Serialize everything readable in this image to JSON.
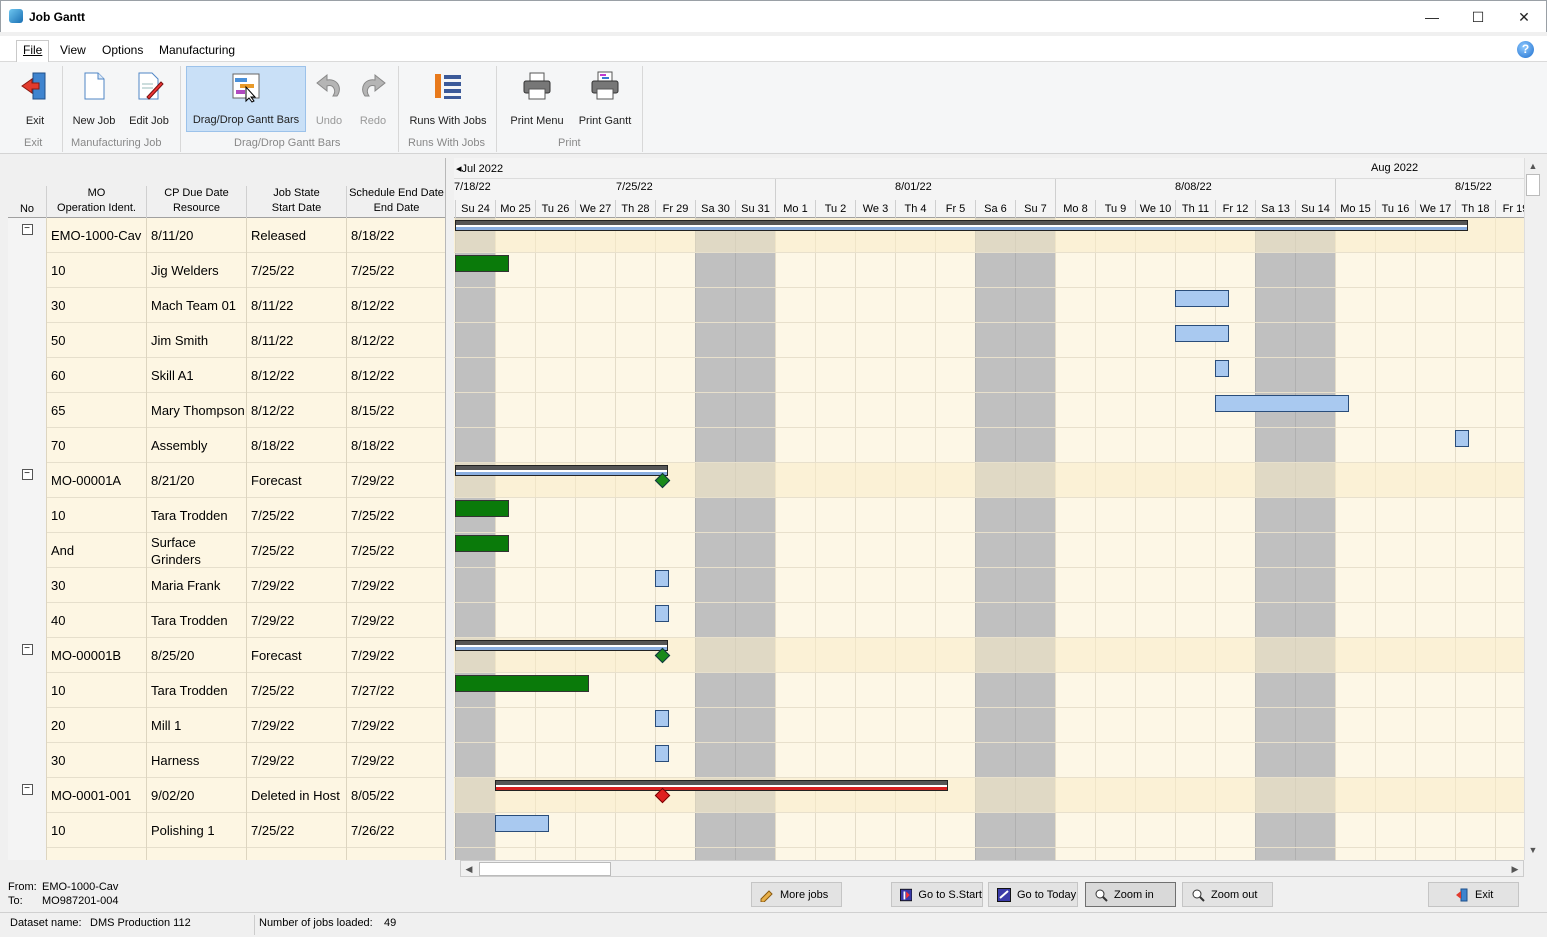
{
  "window": {
    "title": "Job Gantt",
    "minimize": "—",
    "maximize": "☐",
    "close": "✕"
  },
  "menu": {
    "file": "File",
    "view": "View",
    "options": "Options",
    "manufacturing": "Manufacturing",
    "help": "?"
  },
  "ribbon": {
    "exit": "Exit",
    "new_job": "New Job",
    "edit_job": "Edit Job",
    "drag_drop": "Drag/Drop Gantt Bars",
    "undo": "Undo",
    "redo": "Redo",
    "runs_with_jobs": "Runs With Jobs",
    "print_menu": "Print Menu",
    "print_gantt": "Print Gantt",
    "groups": {
      "exit": "Exit",
      "manufacturing_job": "Manufacturing Job",
      "drag_drop": "Drag/Drop Gantt Bars",
      "runs_with_jobs": "Runs With Jobs",
      "print": "Print"
    }
  },
  "grid": {
    "headers": {
      "no": "No",
      "col1_a": "MO",
      "col1_b": "Operation Ident.",
      "col2_a": "CP Due Date",
      "col2_b": "Resource",
      "col3_a": "Job State",
      "col3_b": "Start Date",
      "col4_a": "Schedule End Date",
      "col4_b": "End Date"
    },
    "rows": [
      {
        "toggle": "−",
        "c1": "EMO-1000-Cav",
        "c2": "8/11/20",
        "c3": "Released",
        "c4": "8/18/22"
      },
      {
        "toggle": "",
        "c1": "10",
        "c2": "Jig Welders",
        "c3": "7/25/22",
        "c4": "7/25/22"
      },
      {
        "toggle": "",
        "c1": "30",
        "c2": "Mach Team 01",
        "c3": "8/11/22",
        "c4": "8/12/22"
      },
      {
        "toggle": "",
        "c1": "50",
        "c2": "Jim Smith",
        "c3": "8/11/22",
        "c4": "8/12/22"
      },
      {
        "toggle": "",
        "c1": "60",
        "c2": "Skill A1",
        "c3": "8/12/22",
        "c4": "8/12/22"
      },
      {
        "toggle": "",
        "c1": "65",
        "c2": "Mary Thompson",
        "c3": "8/12/22",
        "c4": "8/15/22"
      },
      {
        "toggle": "",
        "c1": "70",
        "c2": "Assembly",
        "c3": "8/18/22",
        "c4": "8/18/22"
      },
      {
        "toggle": "−",
        "c1": "MO-00001A",
        "c2": "8/21/20",
        "c3": "Forecast",
        "c4": "7/29/22"
      },
      {
        "toggle": "",
        "c1": "10",
        "c2": "Tara Trodden",
        "c3": "7/25/22",
        "c4": "7/25/22"
      },
      {
        "toggle": "",
        "c1": "And",
        "c2": "Surface Grinders",
        "c3": "7/25/22",
        "c4": "7/25/22"
      },
      {
        "toggle": "",
        "c1": "30",
        "c2": "Maria Frank",
        "c3": "7/29/22",
        "c4": "7/29/22"
      },
      {
        "toggle": "",
        "c1": "40",
        "c2": "Tara Trodden",
        "c3": "7/29/22",
        "c4": "7/29/22"
      },
      {
        "toggle": "−",
        "c1": "MO-00001B",
        "c2": "8/25/20",
        "c3": "Forecast",
        "c4": "7/29/22"
      },
      {
        "toggle": "",
        "c1": "10",
        "c2": "Tara Trodden",
        "c3": "7/25/22",
        "c4": "7/27/22"
      },
      {
        "toggle": "",
        "c1": "20",
        "c2": "Mill 1",
        "c3": "7/29/22",
        "c4": "7/29/22"
      },
      {
        "toggle": "",
        "c1": "30",
        "c2": "Harness",
        "c3": "7/29/22",
        "c4": "7/29/22"
      },
      {
        "toggle": "−",
        "c1": "MO-0001-001",
        "c2": "9/02/20",
        "c3": "Deleted in Host",
        "c4": "8/05/22"
      },
      {
        "toggle": "",
        "c1": "10",
        "c2": "Polishing 1",
        "c3": "7/25/22",
        "c4": "7/26/22"
      },
      {
        "toggle": "",
        "c1": "",
        "c2": "",
        "c3": "",
        "c4": ""
      }
    ]
  },
  "gantt": {
    "months": [
      {
        "label": "Jul 2022"
      },
      {
        "label": "Aug 2022"
      }
    ],
    "weeks": [
      "7/18/22",
      "7/25/22",
      "8/01/22",
      "8/08/22",
      "8/15/22"
    ],
    "days": [
      "Su 24",
      "Mo 25",
      "Tu 26",
      "We 27",
      "Th 28",
      "Fr 29",
      "Sa 30",
      "Su 31",
      "Mo 1",
      "Tu 2",
      "We 3",
      "Th 4",
      "Fr 5",
      "Sa 6",
      "Su 7",
      "Mo 8",
      "Tu 9",
      "We 10",
      "Th 11",
      "Fr 12",
      "Sa 13",
      "Su 14",
      "Mo 15",
      "Tu 16",
      "We 17",
      "Th 18",
      "Fr 19"
    ],
    "weekend_days": [
      "Su 24",
      "Sa 30",
      "Su 31",
      "Sa 6",
      "Su 7",
      "Sa 13",
      "Su 14"
    ]
  },
  "bottom": {
    "from_label": "From:",
    "from_value": "EMO-1000-Cav",
    "to_label": "To:",
    "to_value": "MO987201-004",
    "more_jobs": "More jobs",
    "go_to_start": "Go to S.Start",
    "go_to_today": "Go to Today",
    "zoom_in": "Zoom in",
    "zoom_out": "Zoom out",
    "exit": "Exit"
  },
  "status": {
    "dataset_label": "Dataset name:",
    "dataset_value": "DMS Production 112",
    "jobs_label": "Number of jobs loaded:",
    "jobs_value": "49"
  },
  "colors": {
    "accent": "#1a6fb3",
    "weekend": "#c0c0c0",
    "grid_bg": "#fdf6e3",
    "bar_green": "#0a7a0a",
    "bar_blue": "#a9c9f0",
    "bar_red": "#d62020"
  }
}
